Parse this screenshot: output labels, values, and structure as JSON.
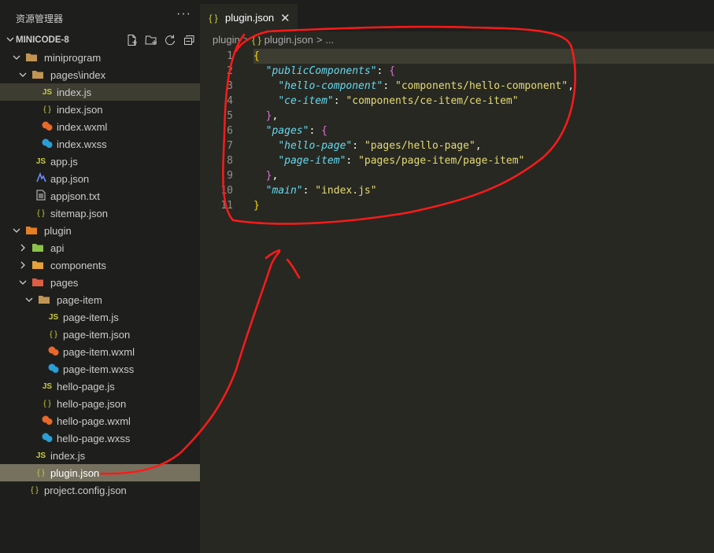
{
  "sidebar": {
    "title": "资源管理器",
    "more": "···",
    "project": "MINICODE-8",
    "actions": [
      "new-file-icon",
      "new-folder-icon",
      "refresh-icon",
      "collapse-all-icon"
    ],
    "items": [
      {
        "label": "miniprogram",
        "level": 0,
        "type": "folder",
        "open": true,
        "icon": "folder"
      },
      {
        "label": "pages\\index",
        "level": 1,
        "type": "folder",
        "open": true,
        "icon": "folder"
      },
      {
        "label": "index.js",
        "level": 2,
        "type": "file",
        "icon": "js",
        "state": "active"
      },
      {
        "label": "index.json",
        "level": 2,
        "type": "file",
        "icon": "json"
      },
      {
        "label": "index.wxml",
        "level": 2,
        "type": "file",
        "icon": "wxml"
      },
      {
        "label": "index.wxss",
        "level": 2,
        "type": "file",
        "icon": "wxss"
      },
      {
        "label": "app.js",
        "level": 1,
        "type": "file",
        "icon": "js"
      },
      {
        "label": "app.json",
        "level": 1,
        "type": "file",
        "icon": "appjson"
      },
      {
        "label": "appjson.txt",
        "level": 1,
        "type": "file",
        "icon": "txt"
      },
      {
        "label": "sitemap.json",
        "level": 1,
        "type": "file",
        "icon": "json"
      },
      {
        "label": "plugin",
        "level": 0,
        "type": "folder",
        "open": true,
        "icon": "folder-plugin"
      },
      {
        "label": "api",
        "level": 1,
        "type": "folder",
        "open": false,
        "icon": "folder-api"
      },
      {
        "label": "components",
        "level": 1,
        "type": "folder",
        "open": false,
        "icon": "folder-components"
      },
      {
        "label": "pages",
        "level": 1,
        "type": "folder",
        "open": true,
        "icon": "folder-pages"
      },
      {
        "label": "page-item",
        "level": 2,
        "type": "folder",
        "open": true,
        "icon": "folder"
      },
      {
        "label": "page-item.js",
        "level": 3,
        "type": "file",
        "icon": "js"
      },
      {
        "label": "page-item.json",
        "level": 3,
        "type": "file",
        "icon": "json"
      },
      {
        "label": "page-item.wxml",
        "level": 3,
        "type": "file",
        "icon": "wxml"
      },
      {
        "label": "page-item.wxss",
        "level": 3,
        "type": "file",
        "icon": "wxss"
      },
      {
        "label": "hello-page.js",
        "level": 2,
        "type": "file",
        "icon": "js"
      },
      {
        "label": "hello-page.json",
        "level": 2,
        "type": "file",
        "icon": "json"
      },
      {
        "label": "hello-page.wxml",
        "level": 2,
        "type": "file",
        "icon": "wxml"
      },
      {
        "label": "hello-page.wxss",
        "level": 2,
        "type": "file",
        "icon": "wxss"
      },
      {
        "label": "index.js",
        "level": 1,
        "type": "file",
        "icon": "js"
      },
      {
        "label": "plugin.json",
        "level": 1,
        "type": "file",
        "icon": "json",
        "state": "selected"
      },
      {
        "label": "project.config.json",
        "level": 0,
        "type": "file",
        "icon": "json"
      }
    ]
  },
  "tab": {
    "icon": "{ }",
    "label": "plugin.json",
    "close": "✕"
  },
  "breadcrumb": {
    "parts": [
      "plugin",
      ">",
      "{ }",
      "plugin.json",
      ">",
      "..."
    ]
  },
  "code": {
    "lines": [
      [
        [
          "br1",
          "{"
        ]
      ],
      [
        [
          "p",
          "  "
        ],
        [
          "k",
          "\"publicComponents\""
        ],
        [
          "p",
          ": "
        ],
        [
          "br2",
          "{"
        ]
      ],
      [
        [
          "p",
          "    "
        ],
        [
          "k",
          "\"hello-component\""
        ],
        [
          "p",
          ": "
        ],
        [
          "s",
          "\"components/hello-component\""
        ],
        [
          "p",
          ","
        ]
      ],
      [
        [
          "p",
          "    "
        ],
        [
          "k",
          "\"ce-item\""
        ],
        [
          "p",
          ": "
        ],
        [
          "s",
          "\"components/ce-item/ce-item\""
        ]
      ],
      [
        [
          "p",
          "  "
        ],
        [
          "br2",
          "}"
        ],
        [
          "p",
          ","
        ]
      ],
      [
        [
          "p",
          "  "
        ],
        [
          "k",
          "\"pages\""
        ],
        [
          "p",
          ": "
        ],
        [
          "br2",
          "{"
        ]
      ],
      [
        [
          "p",
          "    "
        ],
        [
          "k",
          "\"hello-page\""
        ],
        [
          "p",
          ": "
        ],
        [
          "s",
          "\"pages/hello-page\""
        ],
        [
          "p",
          ","
        ]
      ],
      [
        [
          "p",
          "    "
        ],
        [
          "k",
          "\"page-item\""
        ],
        [
          "p",
          ": "
        ],
        [
          "s",
          "\"pages/page-item/page-item\""
        ]
      ],
      [
        [
          "p",
          "  "
        ],
        [
          "br2",
          "}"
        ],
        [
          "p",
          ","
        ]
      ],
      [
        [
          "p",
          "  "
        ],
        [
          "k",
          "\"main\""
        ],
        [
          "p",
          ": "
        ],
        [
          "s",
          "\"index.js\""
        ]
      ],
      [
        [
          "br1",
          "}"
        ]
      ]
    ],
    "current_line": 1
  },
  "colors": {
    "annotation": "#ff1a1a",
    "sidebar_bg": "#1e1f1c",
    "editor_bg": "#272822",
    "selection": "#75715e"
  }
}
